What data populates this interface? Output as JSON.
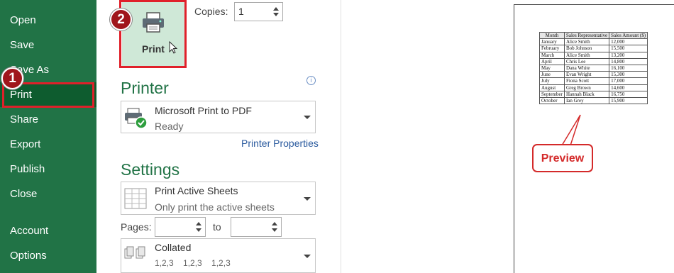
{
  "sidebar": {
    "items": [
      {
        "label": "Open",
        "name": "sidebar-item-open"
      },
      {
        "label": "Save",
        "name": "sidebar-item-save"
      },
      {
        "label": "Save As",
        "name": "sidebar-item-save-as"
      },
      {
        "label": "Print",
        "name": "sidebar-item-print"
      },
      {
        "label": "Share",
        "name": "sidebar-item-share"
      },
      {
        "label": "Export",
        "name": "sidebar-item-export"
      },
      {
        "label": "Publish",
        "name": "sidebar-item-publish"
      },
      {
        "label": "Close",
        "name": "sidebar-item-close"
      },
      {
        "label": "Account",
        "name": "sidebar-item-account"
      },
      {
        "label": "Options",
        "name": "sidebar-item-options"
      }
    ],
    "selected": "Print",
    "accent_color": "#217346"
  },
  "annotations": {
    "step1": "1",
    "step2": "2",
    "preview_callout": "Preview",
    "highlight_color": "#e0202a"
  },
  "print_panel": {
    "print_button_label": "Print",
    "copies_label": "Copies:",
    "copies_value": "1"
  },
  "printer": {
    "heading": "Printer",
    "name": "Microsoft Print to PDF",
    "status": "Ready",
    "properties_link": "Printer Properties",
    "info_icon": "i"
  },
  "settings": {
    "heading": "Settings",
    "scope_main": "Print Active Sheets",
    "scope_sub": "Only print the active sheets",
    "pages_label": "Pages:",
    "pages_from": "",
    "to_label": "to",
    "pages_to": "",
    "collation_main": "Collated",
    "collation_sub": "1,2,3    1,2,3    1,2,3"
  },
  "preview_table": {
    "headers": [
      "Month",
      "Sales Representative",
      "Sales Amount ($)"
    ],
    "rows": [
      [
        "January",
        "Alice Smith",
        "12,000"
      ],
      [
        "February",
        "Bob Johnson",
        "15,500"
      ],
      [
        "March",
        "Alice Smith",
        "13,200"
      ],
      [
        "April",
        "Chris Lee",
        "14,800"
      ],
      [
        "May",
        "Dana White",
        "16,100"
      ],
      [
        "June",
        "Evan Wright",
        "15,300"
      ],
      [
        "July",
        "Fiona Scott",
        "17,000"
      ],
      [
        "August",
        "Greg Brown",
        "14,600"
      ],
      [
        "September",
        "Hannah Black",
        "16,750"
      ],
      [
        "October",
        "Ian Grey",
        "15,900"
      ]
    ]
  }
}
